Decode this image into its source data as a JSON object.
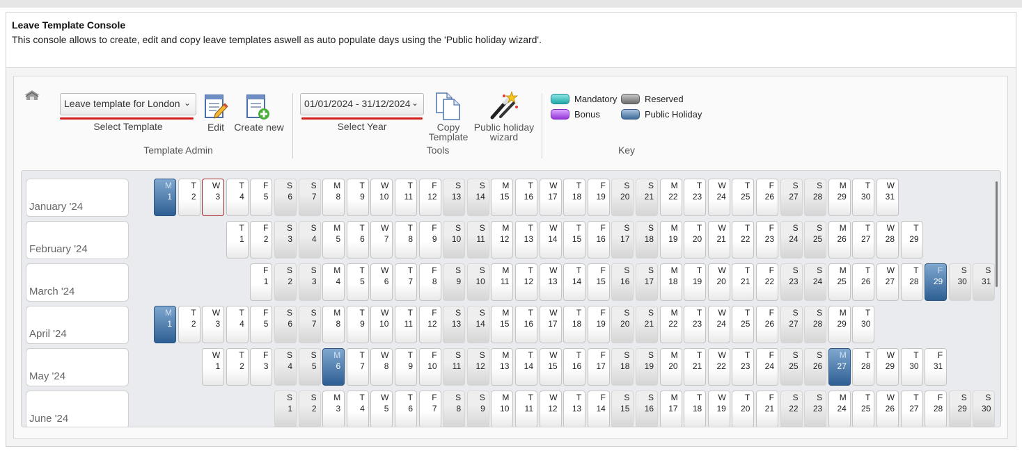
{
  "header": {
    "title": "Leave Template Console",
    "description": "This console allows to create, edit and copy leave templates aswell as auto populate days using the 'Public holiday wizard'."
  },
  "toolbar": {
    "template_select": {
      "value": "Leave template for London",
      "label": "Select Template"
    },
    "edit_label": "Edit",
    "create_new_label": "Create new",
    "template_admin_group": "Template Admin",
    "year_select": {
      "value": "01/01/2024 - 31/12/2024",
      "label": "Select Year"
    },
    "copy_template_label_1": "Copy",
    "copy_template_label_2": "Template",
    "public_holiday_label_1": "Public holiday",
    "public_holiday_label_2": "wizard",
    "tools_group": "Tools",
    "key_group": "Key"
  },
  "key": [
    {
      "label": "Mandatory",
      "color": "#2bbcbc"
    },
    {
      "label": "Reserved",
      "color": "#7d7d7d"
    },
    {
      "label": "Bonus",
      "color": "#a24fe0"
    },
    {
      "label": "Public Holiday",
      "color": "#4f7aa8"
    }
  ],
  "calendar": {
    "months": [
      {
        "name": "January '24",
        "start": "Mon",
        "days": 31,
        "holidays": [
          1
        ],
        "selected": [
          3
        ]
      },
      {
        "name": "February '24",
        "start": "Thu",
        "days": 29,
        "holidays": [],
        "selected": []
      },
      {
        "name": "March '24",
        "start": "Fri",
        "days": 31,
        "holidays": [
          29
        ],
        "selected": []
      },
      {
        "name": "April '24",
        "start": "Mon",
        "days": 30,
        "holidays": [
          1
        ],
        "selected": []
      },
      {
        "name": "May '24",
        "start": "Wed",
        "days": 31,
        "holidays": [
          6,
          27
        ],
        "selected": []
      },
      {
        "name": "June '24",
        "start": "Sat",
        "days": 30,
        "holidays": [],
        "selected": []
      }
    ],
    "weekday_letters": [
      "M",
      "T",
      "W",
      "T",
      "F",
      "S",
      "S"
    ]
  }
}
